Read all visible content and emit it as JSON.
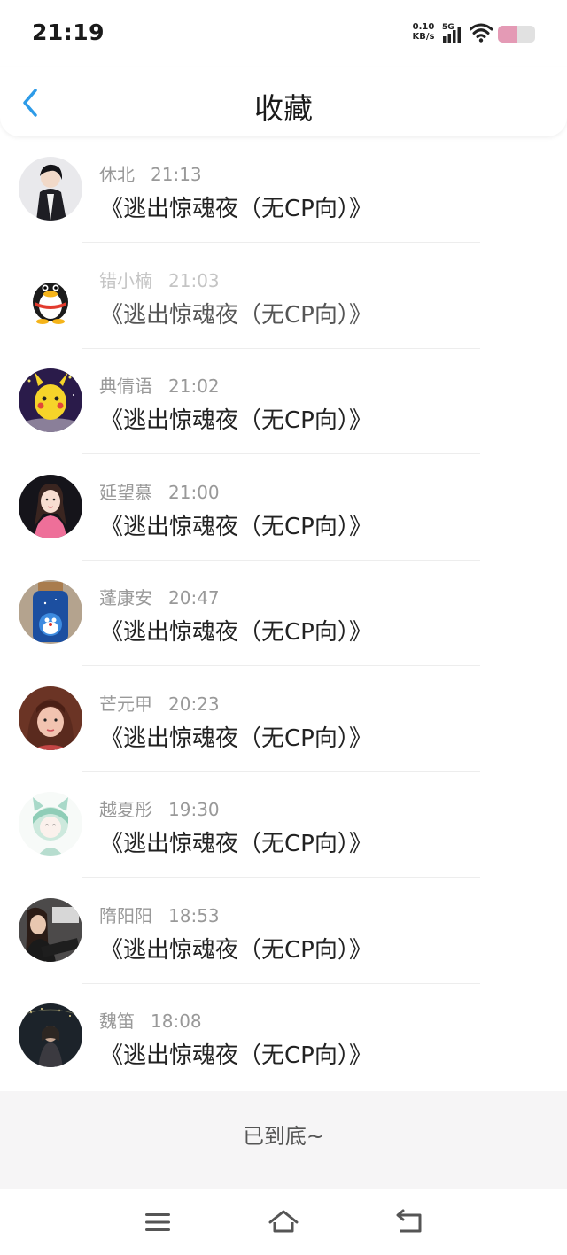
{
  "status_bar": {
    "time": "21:19",
    "net_speed_value": "0.10",
    "net_speed_unit": "KB/s",
    "signal_label": "5G",
    "battery_level_percent": 50,
    "battery_color": "#e49ab5"
  },
  "header": {
    "title": "收藏",
    "back_icon": "chevron-left-icon",
    "accent_color": "#2d9be8"
  },
  "items": [
    {
      "name": "休北",
      "time": "21:13",
      "book": "《逃出惊魂夜（无CP向）》"
    },
    {
      "name": "错小楠",
      "time": "21:03",
      "book": "《逃出惊魂夜（无CP向）》"
    },
    {
      "name": "典倩语",
      "time": "21:02",
      "book": "《逃出惊魂夜（无CP向）》"
    },
    {
      "name": "延望慕",
      "time": "21:00",
      "book": "《逃出惊魂夜（无CP向）》"
    },
    {
      "name": "蓬康安",
      "time": "20:47",
      "book": "《逃出惊魂夜（无CP向）》"
    },
    {
      "name": "芒元甲",
      "time": "20:23",
      "book": "《逃出惊魂夜（无CP向）》"
    },
    {
      "name": "越夏彤",
      "time": "19:30",
      "book": "《逃出惊魂夜（无CP向）》"
    },
    {
      "name": "隋阳阳",
      "time": "18:53",
      "book": "《逃出惊魂夜（无CP向）》"
    },
    {
      "name": "魏笛",
      "time": "18:08",
      "book": "《逃出惊魂夜（无CP向）》"
    }
  ],
  "footer": {
    "text": "已到底~"
  },
  "nav": {
    "icons": [
      "menu-icon",
      "home-icon",
      "back-icon"
    ]
  }
}
